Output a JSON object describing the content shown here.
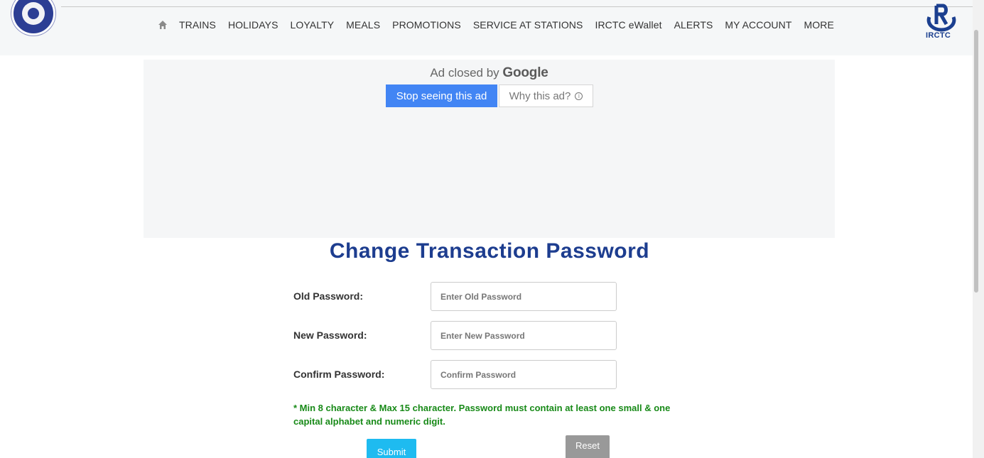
{
  "header": {
    "nav_items": [
      "TRAINS",
      "HOLIDAYS",
      "LOYALTY",
      "MEALS",
      "PROMOTIONS",
      "SERVICE AT STATIONS",
      "IRCTC eWallet",
      "ALERTS",
      "MY ACCOUNT",
      "MORE"
    ],
    "right_logo_text": "IRCTC",
    "icons": {
      "home": "home-icon",
      "left_logo": "indian-railways-logo",
      "right_logo": "irctc-logo"
    }
  },
  "ad": {
    "closed_text": "Ad closed by",
    "brand": "Google",
    "stop_label": "Stop seeing this ad",
    "why_label": "Why this ad?"
  },
  "form": {
    "title": "Change Transaction Password",
    "old_label": "Old Password:",
    "old_placeholder": "Enter Old Password",
    "new_label": "New Password:",
    "new_placeholder": "Enter New Password",
    "confirm_label": "Confirm Password:",
    "confirm_placeholder": "Confirm Password",
    "note": "* Min 8 character & Max 15 character. Password must contain at least one small & one capital alphabet and numeric digit.",
    "submit_label": "Submit",
    "reset_label": "Reset"
  },
  "colors": {
    "title": "#1d3d8f",
    "note": "#188a18",
    "submit": "#1ebbf0",
    "reset": "#999999",
    "ad_button": "#4285f4"
  }
}
